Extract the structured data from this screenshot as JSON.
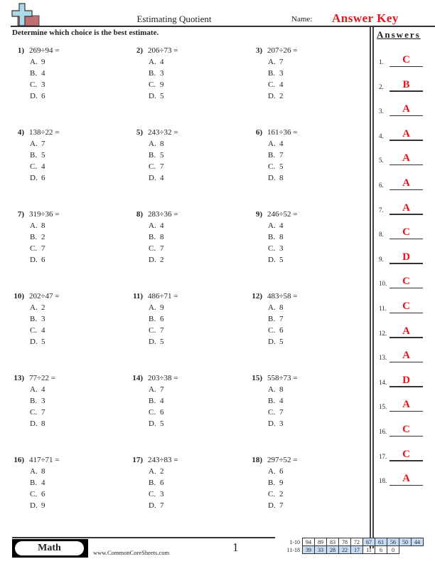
{
  "header": {
    "title": "Estimating Quotient",
    "name_label": "Name:",
    "name_value": "Answer Key",
    "instructions": "Determine which choice is the best estimate."
  },
  "answers_panel": {
    "title": "Answers",
    "items": [
      {
        "num": "1.",
        "answer": "C"
      },
      {
        "num": "2.",
        "answer": "B"
      },
      {
        "num": "3.",
        "answer": "A"
      },
      {
        "num": "4.",
        "answer": "A"
      },
      {
        "num": "5.",
        "answer": "A"
      },
      {
        "num": "6.",
        "answer": "A"
      },
      {
        "num": "7.",
        "answer": "A"
      },
      {
        "num": "8.",
        "answer": "C"
      },
      {
        "num": "9.",
        "answer": "D"
      },
      {
        "num": "10.",
        "answer": "C"
      },
      {
        "num": "11.",
        "answer": "C"
      },
      {
        "num": "12.",
        "answer": "A"
      },
      {
        "num": "13.",
        "answer": "A"
      },
      {
        "num": "14.",
        "answer": "D"
      },
      {
        "num": "15.",
        "answer": "A"
      },
      {
        "num": "16.",
        "answer": "C"
      },
      {
        "num": "17.",
        "answer": "C"
      },
      {
        "num": "18.",
        "answer": "A"
      }
    ]
  },
  "problems": [
    {
      "num": "1)",
      "expr": "269÷94 =",
      "choices": [
        {
          "label": "A.",
          "value": "9"
        },
        {
          "label": "B.",
          "value": "4"
        },
        {
          "label": "C.",
          "value": "3"
        },
        {
          "label": "D.",
          "value": "6"
        }
      ]
    },
    {
      "num": "2)",
      "expr": "206÷73 =",
      "choices": [
        {
          "label": "A.",
          "value": "4"
        },
        {
          "label": "B.",
          "value": "3"
        },
        {
          "label": "C.",
          "value": "9"
        },
        {
          "label": "D.",
          "value": "5"
        }
      ]
    },
    {
      "num": "3)",
      "expr": "207÷26 =",
      "choices": [
        {
          "label": "A.",
          "value": "7"
        },
        {
          "label": "B.",
          "value": "3"
        },
        {
          "label": "C.",
          "value": "4"
        },
        {
          "label": "D.",
          "value": "2"
        }
      ]
    },
    {
      "num": "4)",
      "expr": "138÷22 =",
      "choices": [
        {
          "label": "A.",
          "value": "7"
        },
        {
          "label": "B.",
          "value": "5"
        },
        {
          "label": "C.",
          "value": "4"
        },
        {
          "label": "D.",
          "value": "6"
        }
      ]
    },
    {
      "num": "5)",
      "expr": "243÷32 =",
      "choices": [
        {
          "label": "A.",
          "value": "8"
        },
        {
          "label": "B.",
          "value": "5"
        },
        {
          "label": "C.",
          "value": "7"
        },
        {
          "label": "D.",
          "value": "4"
        }
      ]
    },
    {
      "num": "6)",
      "expr": "161÷36 =",
      "choices": [
        {
          "label": "A.",
          "value": "4"
        },
        {
          "label": "B.",
          "value": "7"
        },
        {
          "label": "C.",
          "value": "5"
        },
        {
          "label": "D.",
          "value": "8"
        }
      ]
    },
    {
      "num": "7)",
      "expr": "319÷36 =",
      "choices": [
        {
          "label": "A.",
          "value": "8"
        },
        {
          "label": "B.",
          "value": "2"
        },
        {
          "label": "C.",
          "value": "7"
        },
        {
          "label": "D.",
          "value": "6"
        }
      ]
    },
    {
      "num": "8)",
      "expr": "283÷36 =",
      "choices": [
        {
          "label": "A.",
          "value": "4"
        },
        {
          "label": "B.",
          "value": "8"
        },
        {
          "label": "C.",
          "value": "7"
        },
        {
          "label": "D.",
          "value": "2"
        }
      ]
    },
    {
      "num": "9)",
      "expr": "246÷52 =",
      "choices": [
        {
          "label": "A.",
          "value": "4"
        },
        {
          "label": "B.",
          "value": "8"
        },
        {
          "label": "C.",
          "value": "3"
        },
        {
          "label": "D.",
          "value": "5"
        }
      ]
    },
    {
      "num": "10)",
      "expr": "202÷47 =",
      "choices": [
        {
          "label": "A.",
          "value": "2"
        },
        {
          "label": "B.",
          "value": "3"
        },
        {
          "label": "C.",
          "value": "4"
        },
        {
          "label": "D.",
          "value": "5"
        }
      ]
    },
    {
      "num": "11)",
      "expr": "486÷71 =",
      "choices": [
        {
          "label": "A.",
          "value": "9"
        },
        {
          "label": "B.",
          "value": "6"
        },
        {
          "label": "C.",
          "value": "7"
        },
        {
          "label": "D.",
          "value": "5"
        }
      ]
    },
    {
      "num": "12)",
      "expr": "483÷58 =",
      "choices": [
        {
          "label": "A.",
          "value": "8"
        },
        {
          "label": "B.",
          "value": "7"
        },
        {
          "label": "C.",
          "value": "6"
        },
        {
          "label": "D.",
          "value": "5"
        }
      ]
    },
    {
      "num": "13)",
      "expr": "77÷22 =",
      "choices": [
        {
          "label": "A.",
          "value": "4"
        },
        {
          "label": "B.",
          "value": "3"
        },
        {
          "label": "C.",
          "value": "7"
        },
        {
          "label": "D.",
          "value": "8"
        }
      ]
    },
    {
      "num": "14)",
      "expr": "203÷38 =",
      "choices": [
        {
          "label": "A.",
          "value": "7"
        },
        {
          "label": "B.",
          "value": "4"
        },
        {
          "label": "C.",
          "value": "6"
        },
        {
          "label": "D.",
          "value": "5"
        }
      ]
    },
    {
      "num": "15)",
      "expr": "558÷73 =",
      "choices": [
        {
          "label": "A.",
          "value": "8"
        },
        {
          "label": "B.",
          "value": "4"
        },
        {
          "label": "C.",
          "value": "7"
        },
        {
          "label": "D.",
          "value": "3"
        }
      ]
    },
    {
      "num": "16)",
      "expr": "417÷71 =",
      "choices": [
        {
          "label": "A.",
          "value": "8"
        },
        {
          "label": "B.",
          "value": "4"
        },
        {
          "label": "C.",
          "value": "6"
        },
        {
          "label": "D.",
          "value": "9"
        }
      ]
    },
    {
      "num": "17)",
      "expr": "243÷83 =",
      "choices": [
        {
          "label": "A.",
          "value": "2"
        },
        {
          "label": "B.",
          "value": "6"
        },
        {
          "label": "C.",
          "value": "3"
        },
        {
          "label": "D.",
          "value": "7"
        }
      ]
    },
    {
      "num": "18)",
      "expr": "297÷52 =",
      "choices": [
        {
          "label": "A.",
          "value": "6"
        },
        {
          "label": "B.",
          "value": "9"
        },
        {
          "label": "C.",
          "value": "2"
        },
        {
          "label": "D.",
          "value": "7"
        }
      ]
    }
  ],
  "footer": {
    "subject": "Math",
    "site": "www.CommonCoreSheets.com",
    "page": "1",
    "score_rows": [
      {
        "label": "1-10",
        "cells": [
          {
            "v": "94",
            "hl": false
          },
          {
            "v": "89",
            "hl": false
          },
          {
            "v": "83",
            "hl": false
          },
          {
            "v": "78",
            "hl": false
          },
          {
            "v": "72",
            "hl": false
          },
          {
            "v": "67",
            "hl": true
          },
          {
            "v": "61",
            "hl": true
          },
          {
            "v": "56",
            "hl": true
          },
          {
            "v": "50",
            "hl": true
          },
          {
            "v": "44",
            "hl": true
          }
        ]
      },
      {
        "label": "11-18",
        "cells": [
          {
            "v": "39",
            "hl": true
          },
          {
            "v": "33",
            "hl": true
          },
          {
            "v": "28",
            "hl": true
          },
          {
            "v": "22",
            "hl": true
          },
          {
            "v": "17",
            "hl": true
          },
          {
            "v": "11",
            "hl": false
          },
          {
            "v": "6",
            "hl": false
          },
          {
            "v": "0",
            "hl": false
          }
        ]
      }
    ]
  },
  "colors": {
    "answer_red": "#e8141c",
    "score_highlight": "#c6dcf5",
    "logo_cross": "#add8e6",
    "logo_bar": "#c07070"
  }
}
